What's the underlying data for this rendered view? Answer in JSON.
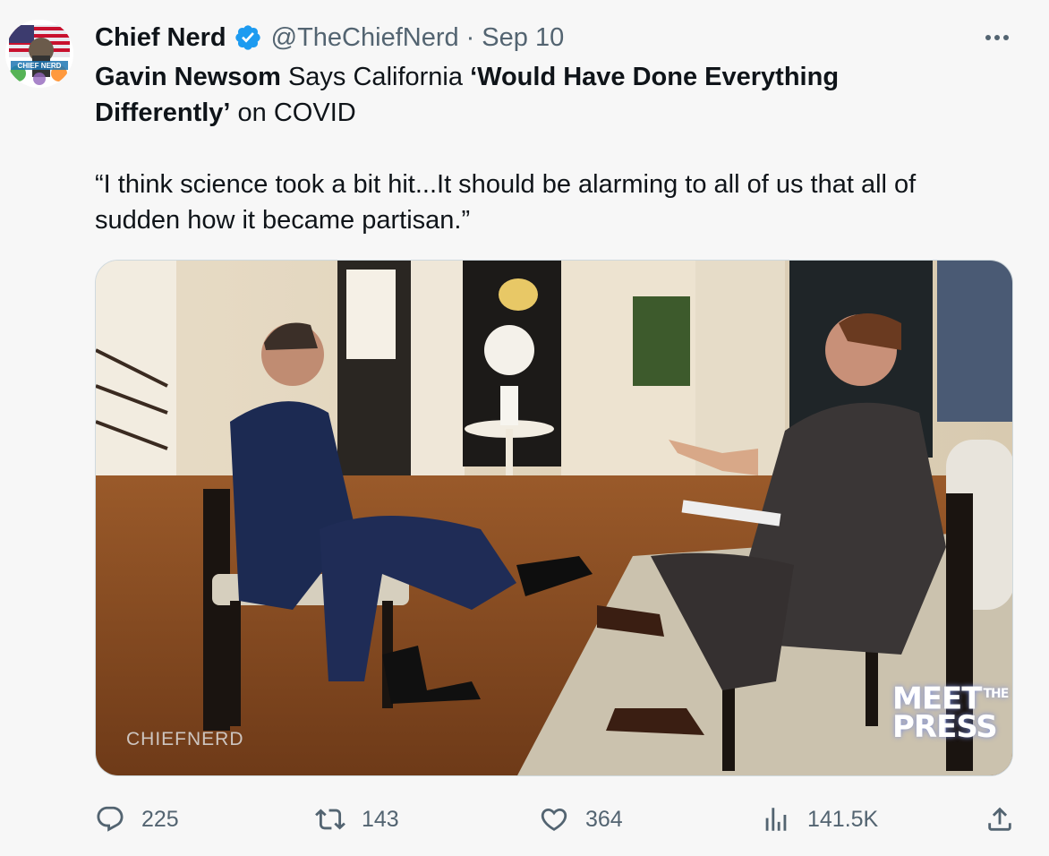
{
  "tweet": {
    "author_name": "Chief Nerd",
    "handle": "@TheChiefNerd",
    "separator": "·",
    "date": "Sep 10",
    "avatar_text": "CHIEF NERD",
    "line1_bold1": "Gavin Newsom",
    "line1_regular": " Says California ",
    "line1_bold2": "‘Would Have Done Everything",
    "line2_bold": "Differently’",
    "line2_regular": " on COVID",
    "quote_line1": "“I think science took a bit hit...It should be alarming to all of us that all of",
    "quote_line2": "sudden how it became partisan.”"
  },
  "media": {
    "watermark": "CHIEFNERD",
    "logo_meet": "MEET",
    "logo_the": "THE",
    "logo_press": "PRESS"
  },
  "actions": {
    "replies": "225",
    "retweets": "143",
    "likes": "364",
    "views": "141.5K"
  },
  "icons": {
    "verified": "verified-badge-icon",
    "more": "more-icon",
    "reply": "reply-icon",
    "retweet": "retweet-icon",
    "like": "heart-icon",
    "views": "views-icon",
    "share": "share-icon"
  },
  "colors": {
    "background": "#f7f7f7",
    "text": "#0f1419",
    "secondary": "#536471",
    "verified": "#1d9bf0"
  }
}
